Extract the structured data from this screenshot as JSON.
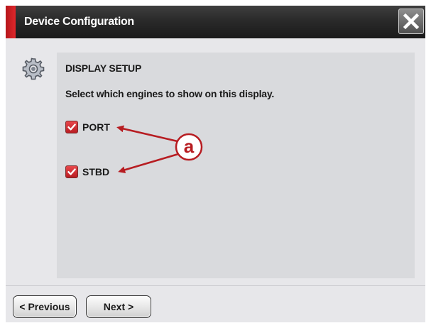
{
  "window": {
    "title": "Device Configuration",
    "close_icon": "close-icon",
    "accent_color": "#d2232a"
  },
  "section": {
    "heading": "DISPLAY SETUP",
    "icon": "gear-icon",
    "instruction": "Select which engines to show on this display."
  },
  "options": [
    {
      "label": "PORT",
      "checked": true
    },
    {
      "label": "STBD",
      "checked": true
    }
  ],
  "callout": {
    "letter": "a",
    "color": "#b71c21"
  },
  "buttons": {
    "previous": "< Previous",
    "next": "Next >"
  }
}
